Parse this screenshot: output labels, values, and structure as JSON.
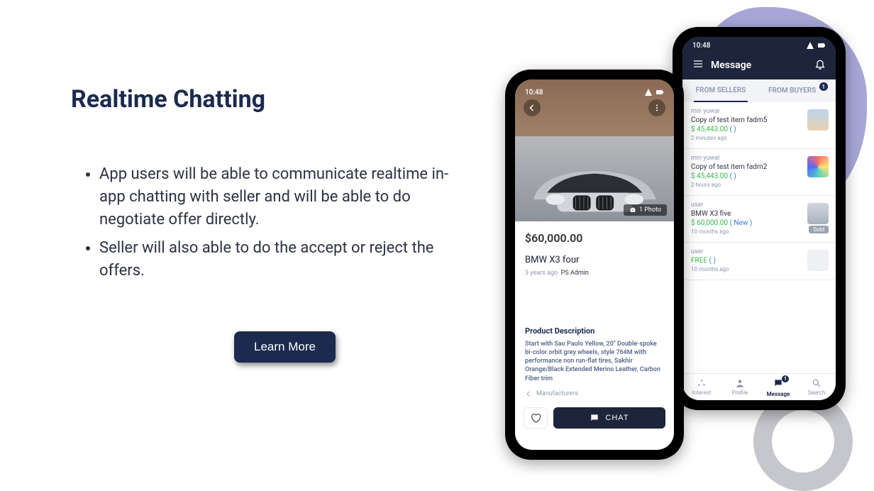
{
  "heading": "Realtime Chatting",
  "bullets": [
    "App users will be able to communicate realtime in-app chatting with seller and will be able to do negotiate offer directly.",
    "Seller will also able to do the accept or reject the offers."
  ],
  "cta_label": "Learn More",
  "phone_a": {
    "status_time": "10:48",
    "photo_chip": "1  Photo",
    "price": "$60,000.00",
    "title": "BMW X3 four",
    "meta_time": "3 years ago",
    "meta_author": "PS Admin",
    "section_heading": "Product Description",
    "description": "Start with Sao Paulo Yellow, 20\" Double-spoke bi-color orbit grey wheels, style 764M with performance non run-flat tires, Sakhir Orange/Black Extended Merino Leather, Carbon Fiber trim",
    "breadcrumb": "Manufacturers",
    "chat_label": "CHAT"
  },
  "phone_b": {
    "status_time": "10:48",
    "header_title": "Message",
    "tabs": {
      "sellers": "FROM SELLERS",
      "buyers": "FROM BUYERS",
      "buyers_badge": "1"
    },
    "messages": [
      {
        "sender": "min yuwai",
        "subject": "Copy of test item fadm5",
        "price": "$ 45,443.00",
        "extra": "( )",
        "ago": "2 minutes ago",
        "sold": false
      },
      {
        "sender": "min yuwai",
        "subject": "Copy of test item fadm2",
        "price": "$ 45,443.00",
        "extra": "( )",
        "ago": "2 hours ago",
        "sold": false
      },
      {
        "sender": "user",
        "subject": "BMW X3 five",
        "price": "$ 60,000.00",
        "extra": "( New )",
        "ago": "10 months ago",
        "sold": true,
        "sold_label": "Sold"
      },
      {
        "sender": "user",
        "subject": "",
        "price": "FREE",
        "extra": "( )",
        "ago": "10 months ago",
        "sold": false
      }
    ],
    "nav": {
      "interest": "Interest",
      "profile": "Profile",
      "message": "Message",
      "search": "Search",
      "message_badge": "1"
    }
  }
}
